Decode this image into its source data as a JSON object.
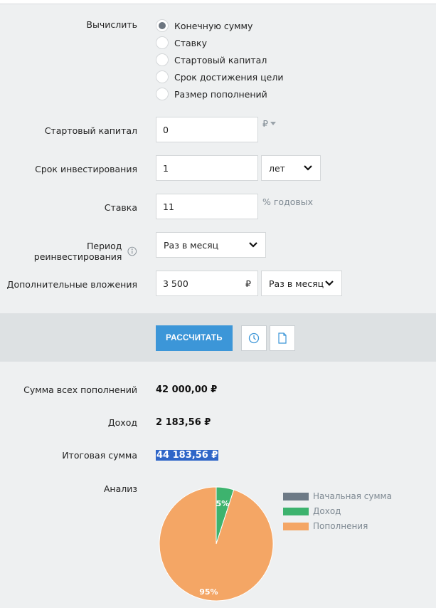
{
  "calc": {
    "label": "Вычислить",
    "options": [
      "Конечную сумму",
      "Ставку",
      "Стартовый капитал",
      "Срок достижения цели",
      "Размер пополнений"
    ],
    "selected_index": 0
  },
  "start_capital": {
    "label": "Стартовый капитал",
    "value": "0",
    "currency": "₽"
  },
  "term": {
    "label": "Срок инвестирования",
    "value": "1",
    "unit": "лет"
  },
  "rate": {
    "label": "Ставка",
    "value": "11",
    "suffix": "% годовых"
  },
  "reinvest": {
    "label": "Период реинвестирования",
    "value": "Раз в месяц",
    "info_icon": "info-icon"
  },
  "extra": {
    "label": "Дополнительные вложения",
    "value": "3 500",
    "currency": "₽",
    "period": "Раз в месяц"
  },
  "actions": {
    "calculate": "РАССЧИТАТЬ",
    "history_icon": "clock-icon",
    "document_icon": "document-icon"
  },
  "results": {
    "total_contrib_label": "Сумма всех пополнений",
    "total_contrib_value": "42 000,00 ₽",
    "income_label": "Доход",
    "income_value": "2 183,56 ₽",
    "final_label": "Итоговая сумма",
    "final_value": "44 183,56 ₽",
    "analysis_label": "Анализ"
  },
  "chart_data": {
    "type": "pie",
    "legend_position": "right",
    "slices": [
      {
        "name": "Начальная сумма",
        "percent": 0,
        "color": "#6d7a86"
      },
      {
        "name": "Доход",
        "percent": 5,
        "color": "#3db36e"
      },
      {
        "name": "Пополнения",
        "percent": 95,
        "color": "#f4a665"
      }
    ],
    "data_labels": [
      "5%",
      "95%"
    ]
  },
  "colors": {
    "primary": "#3c96d8",
    "highlight": "#2f66c8"
  }
}
